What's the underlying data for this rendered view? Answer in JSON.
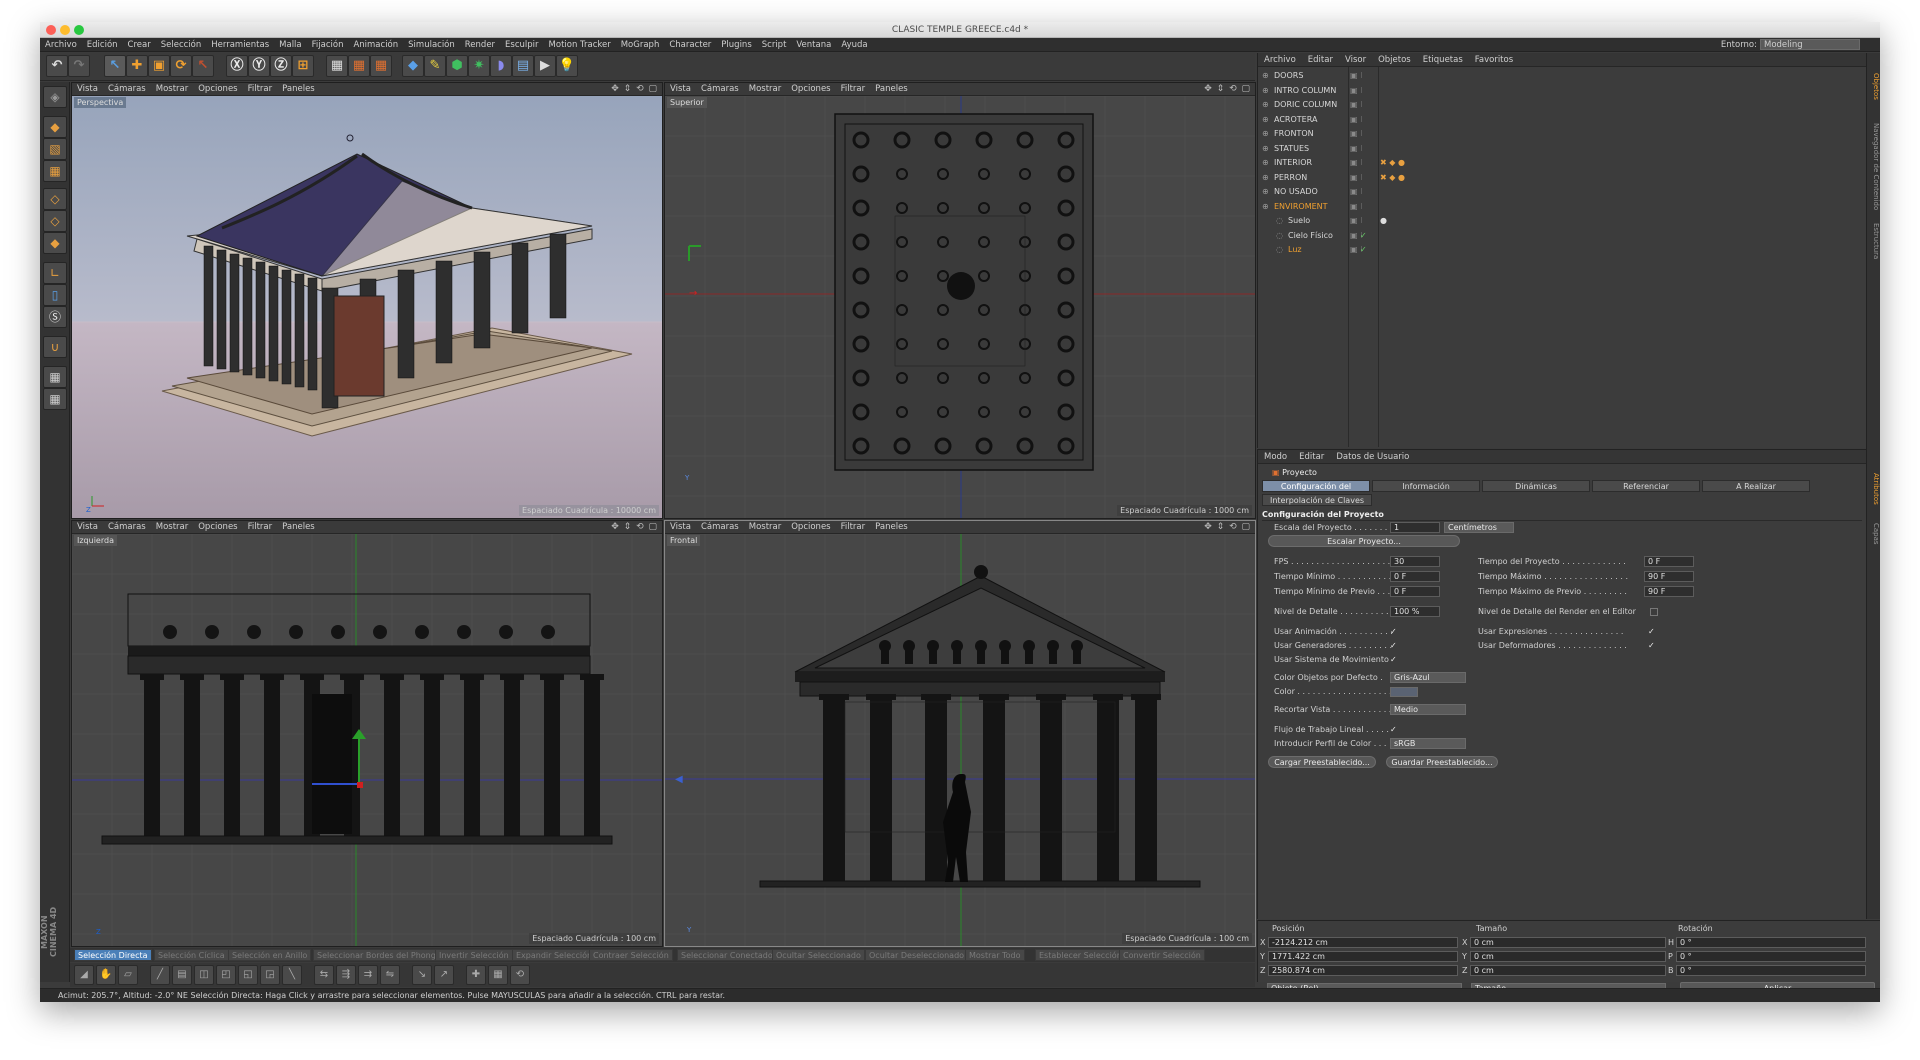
{
  "window": {
    "title": "CLASIC TEMPLE GREECE.c4d *"
  },
  "menu": [
    "Archivo",
    "Edición",
    "Crear",
    "Selección",
    "Herramientas",
    "Malla",
    "Fijación",
    "Animación",
    "Simulación",
    "Render",
    "Esculpir",
    "Motion Tracker",
    "MoGraph",
    "Character",
    "Plugins",
    "Script",
    "Ventana",
    "Ayuda"
  ],
  "environment": {
    "label": "Entorno:",
    "value": "Modeling"
  },
  "viewport_menu": [
    "Vista",
    "Cámaras",
    "Mostrar",
    "Opciones",
    "Filtrar",
    "Paneles"
  ],
  "viewports": {
    "perspective": {
      "title": "Perspectiva",
      "grid": "Espaciado Cuadrícula : 10000 cm"
    },
    "top": {
      "title": "Superior",
      "grid": "Espaciado Cuadrícula : 1000 cm"
    },
    "left": {
      "title": "Izquierda",
      "grid": "Espaciado Cuadrícula : 100 cm"
    },
    "front": {
      "title": "Frontal",
      "grid": "Espaciado Cuadrícula : 100 cm"
    }
  },
  "objects": {
    "menu": [
      "Archivo",
      "Editar",
      "Visor",
      "Objetos",
      "Etiquetas",
      "Favoritos"
    ],
    "items": [
      {
        "name": "DOORS",
        "color": "#d8d8d8"
      },
      {
        "name": "INTRO COLUMN",
        "color": "#d8d8d8"
      },
      {
        "name": "DORIC COLUMN",
        "color": "#d8d8d8"
      },
      {
        "name": "ACROTERA",
        "color": "#d8d8d8"
      },
      {
        "name": "FRONTON",
        "color": "#d8d8d8"
      },
      {
        "name": "STATUES",
        "color": "#d8d8d8"
      },
      {
        "name": "INTERIOR",
        "color": "#d8d8d8"
      },
      {
        "name": "PERRON",
        "color": "#d8d8d8"
      },
      {
        "name": "NO USADO",
        "color": "#d8d8d8"
      },
      {
        "name": "ENVIROMENT",
        "color": "#f0a030"
      },
      {
        "name": "Suelo",
        "color": "#d8d8d8"
      },
      {
        "name": "Cielo Físico",
        "color": "#d8d8d8"
      },
      {
        "name": "Luz",
        "color": "#f0a030"
      }
    ]
  },
  "attributes": {
    "menu": [
      "Modo",
      "Editar",
      "Datos de Usuario"
    ],
    "header": "Proyecto",
    "tabs": [
      "Configuración del Proyecto",
      "Información",
      "Dinámicas",
      "Referenciar",
      "A Realizar"
    ],
    "tab2": "Interpolación de Claves",
    "section": "Configuración del Proyecto",
    "scale_label": "Escala del Proyecto . . . . . . .",
    "scale_value": "1",
    "scale_unit": "Centímetros",
    "scale_button": "Escalar Proyecto...",
    "fps_label": "FPS . . . . . . . . . . . . . . . . . . . . .",
    "fps_value": "30",
    "tmin_label": "Tiempo Mínimo . . . . . . . . . . .",
    "tmin_value": "0 F",
    "tminprev_label": "Tiempo Mínimo de Previo . . .",
    "tminprev_value": "0 F",
    "detail_label": "Nivel de Detalle . . . . . . . . . .",
    "detail_value": "100 %",
    "tproj_label": "Tiempo del Proyecto . . . . . . . . . . . . .",
    "tproj_value": "0 F",
    "tmax_label": "Tiempo Máximo . . . . . . . . . . . . . . . . .",
    "tmax_value": "90 F",
    "tmaxprev_label": "Tiempo Máximo de Previo . . . . . . . . .",
    "tmaxprev_value": "90 F",
    "renderdetail_label": "Nivel de Detalle del Render en el Editor",
    "useanim_label": "Usar Animación . . . . . . . . . . .",
    "usegen_label": "Usar Generadores . . . . . . . . .",
    "usemotion_label": "Usar Sistema de Movimiento",
    "useexpr_label": "Usar Expresiones . . . . . . . . . . . . . . .",
    "usedef_label": "Usar Deformadores . . . . . . . . . . . . . .",
    "objcolor_label": "Color Objetos por Defecto .",
    "objcolor_value": "Gris-Azul",
    "color_label": "Color . . . . . . . . . . . . . . . . . . . .",
    "crop_label": "Recortar Vista . . . . . . . . . . . .",
    "crop_value": "Medio",
    "linear_label": "Flujo de Trabajo Lineal . . . . .",
    "profile_label": "Introducir Perfil de Color . . .",
    "profile_value": "sRGB",
    "load_button": "Cargar Preestablecido...",
    "save_button": "Guardar Preestablecido..."
  },
  "coords": {
    "col_pos": "Posición",
    "col_size": "Tamaño",
    "col_rot": "Rotación",
    "px": "-2124.212 cm",
    "py": "1771.422 cm",
    "pz": "2580.874 cm",
    "sx": "0 cm",
    "sy": "0 cm",
    "sz": "0 cm",
    "rh": "0 °",
    "rp": "0 °",
    "rb": "0 °",
    "mode1": "Objeto (Rel)",
    "mode2": "Tamaño",
    "apply": "Aplicar",
    "ax": "X",
    "ay": "Y",
    "az": "Z",
    "ah": "H",
    "ap": "P",
    "ab": "B"
  },
  "selection_modes": [
    "Selección Directa",
    "Selección Cíclica",
    "Selección en Anillo",
    "Seleccionar Bordes del Phong",
    "Invertir Selección",
    "Expandir Selección",
    "Contraer Selección",
    "Seleccionar Conectado",
    "Ocultar Seleccionado",
    "Ocultar Deseleccionado",
    "Mostrar Todo",
    "Establecer Selección",
    "Convertir Selección"
  ],
  "status": "Acimut: 205.7°, Altitud: -2.0°  NE      Selección Directa: Haga Click y arrastre para seleccionar elementos. Pulse MAYUSCULAS para añadir a la selección. CTRL para restar.",
  "brand": "MAXON CINEMA 4D",
  "right_strip": [
    "Objetos",
    "Navegador de Contenido",
    "Estructura",
    "Atributos",
    "Capas"
  ]
}
